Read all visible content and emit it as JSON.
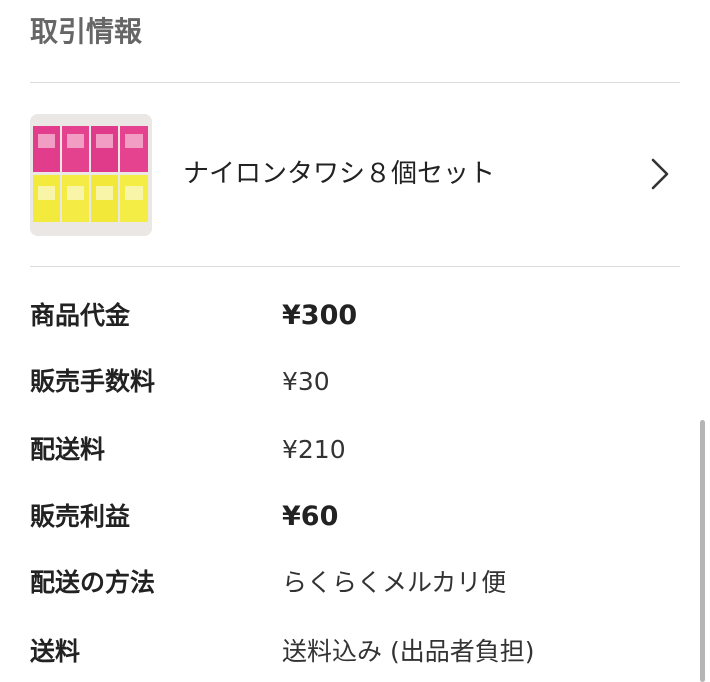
{
  "section": {
    "title": "取引情報"
  },
  "product": {
    "title": "ナイロンタワシ８個セット",
    "thumbnail_icon": "product-photo",
    "chevron_icon": "chevron-right-icon"
  },
  "details": {
    "price_label": "商品代金",
    "price_value": "¥300",
    "fee_label": "販売手数料",
    "fee_value": "¥30",
    "shipping_fee_label": "配送料",
    "shipping_fee_value": "¥210",
    "profit_label": "販売利益",
    "profit_value": "¥60",
    "shipping_method_label": "配送の方法",
    "shipping_method_value": "らくらくメルカリ便",
    "postage_label": "送料",
    "postage_value": "送料込み (出品者負担)"
  },
  "colors": {
    "header_text": "#666666",
    "divider": "#dddddd",
    "thumb_pink": "#e23d8c",
    "thumb_yellow": "#f2ea3c"
  }
}
